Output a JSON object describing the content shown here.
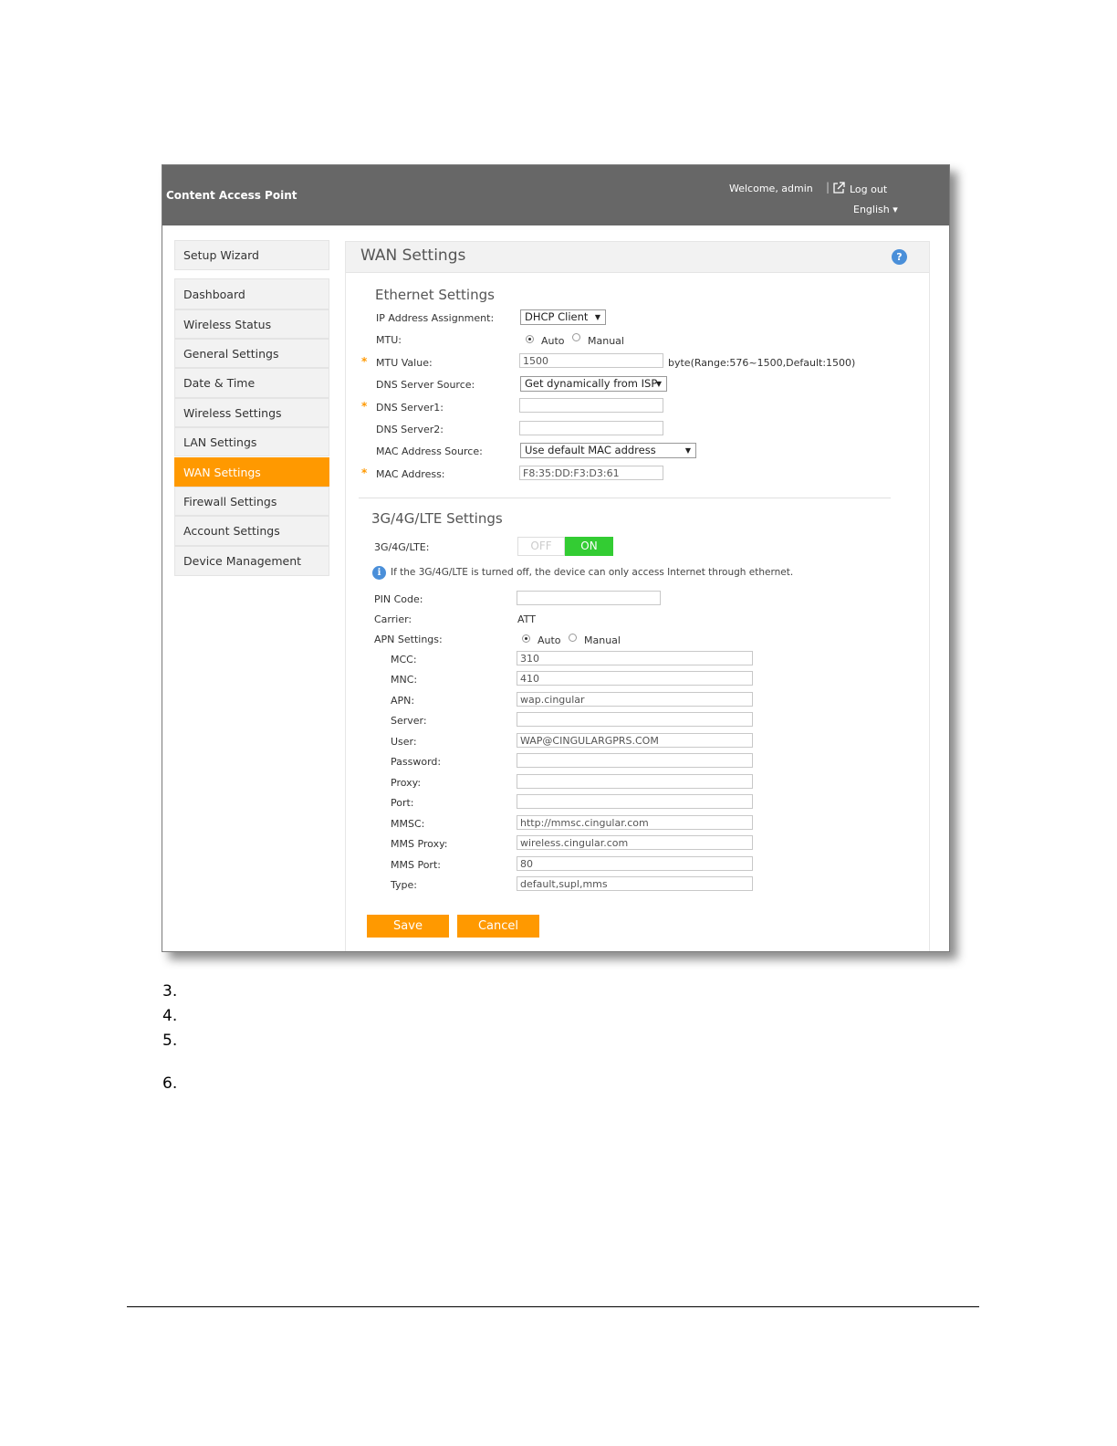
{
  "header": {
    "brand": "Content Access Point",
    "welcome": "Welcome, admin",
    "separator": "|",
    "logout": "Log out",
    "language": "English ▾"
  },
  "sidebar": {
    "items": [
      {
        "label": "Setup Wizard"
      },
      {
        "label": "Dashboard"
      },
      {
        "label": "Wireless Status"
      },
      {
        "label": "General Settings"
      },
      {
        "label": "Date & Time"
      },
      {
        "label": "Wireless Settings"
      },
      {
        "label": "LAN Settings"
      },
      {
        "label": "WAN Settings",
        "active": true
      },
      {
        "label": "Firewall Settings"
      },
      {
        "label": "Account Settings"
      },
      {
        "label": "Device Management"
      }
    ]
  },
  "panel": {
    "title": "WAN Settings",
    "help": "?"
  },
  "ethernet": {
    "title": "Ethernet Settings",
    "ip_label": "IP Address Assignment:",
    "ip_value": "DHCP Client",
    "mtu_label": "MTU:",
    "mtu_auto": "Auto",
    "mtu_manual": "Manual",
    "mtu_selected": "Auto",
    "mtu_value_label": "MTU Value:",
    "mtu_value": "1500",
    "mtu_hint": "byte(Range:576~1500,Default:1500)",
    "dns_source_label": "DNS Server Source:",
    "dns_source_value": "Get dynamically from ISP",
    "dns1_label": "DNS Server1:",
    "dns1_value": "",
    "dns2_label": "DNS Server2:",
    "dns2_value": "",
    "mac_source_label": "MAC Address Source:",
    "mac_source_value": "Use default MAC address",
    "mac_label": "MAC Address:",
    "mac_value": "F8:35:DD:F3:D3:61",
    "required_mark": "*",
    "dropdown_arrow": "▼"
  },
  "lte": {
    "title": "3G/4G/LTE Settings",
    "toggle_label": "3G/4G/LTE:",
    "toggle_off": "OFF",
    "toggle_on": "ON",
    "toggle_state": "ON",
    "info_icon": "i",
    "note": "If the 3G/4G/LTE is turned off, the device can only access Internet through ethernet.",
    "pin_label": "PIN Code:",
    "pin_value": "",
    "carrier_label": "Carrier:",
    "carrier_value": "ATT",
    "apn_settings_label": "APN Settings:",
    "apn_auto": "Auto",
    "apn_manual": "Manual",
    "apn_selected": "Auto",
    "fields": [
      {
        "label": "MCC:",
        "value": "310"
      },
      {
        "label": "MNC:",
        "value": "410"
      },
      {
        "label": "APN:",
        "value": "wap.cingular"
      },
      {
        "label": "Server:",
        "value": ""
      },
      {
        "label": "User:",
        "value": "WAP@CINGULARGPRS.COM"
      },
      {
        "label": "Password:",
        "value": ""
      },
      {
        "label": "Proxy:",
        "value": ""
      },
      {
        "label": "Port:",
        "value": ""
      },
      {
        "label": "MMSC:",
        "value": "http://mmsc.cingular.com"
      },
      {
        "label": "MMS Proxy:",
        "value": "wireless.cingular.com"
      },
      {
        "label": "MMS Port:",
        "value": "80"
      },
      {
        "label": "Type:",
        "value": "default,supl,mms"
      }
    ]
  },
  "buttons": {
    "save": "Save",
    "cancel": "Cancel"
  },
  "document": {
    "list_numbers": [
      "3.",
      "4.",
      "5.",
      "6."
    ]
  }
}
